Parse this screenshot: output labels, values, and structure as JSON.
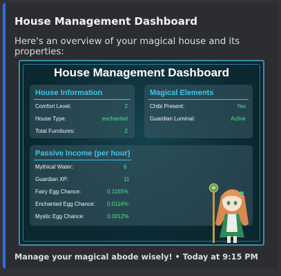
{
  "embed": {
    "title": "House Management Dashboard",
    "description": "Here's an overview of your magical house and its properties:",
    "accent_color": "#2f6fdf",
    "footer": "Manage your magical abode wisely! • Today at 9:15 PM"
  },
  "dashboard": {
    "title": "House Management Dashboard",
    "house_info": {
      "title": "House Information",
      "rows": [
        {
          "label": "Comfort Level:",
          "value": "2"
        },
        {
          "label": "House Type:",
          "value": "enchanted"
        },
        {
          "label": "Total Furnitures:",
          "value": "2"
        }
      ]
    },
    "magical_elements": {
      "title": "Magical Elements",
      "rows": [
        {
          "label": "Chibi Present:",
          "value": "Yes"
        },
        {
          "label": "Guardian Luminal:",
          "value": "Active"
        }
      ]
    },
    "passive_income": {
      "title": "Passive Income (per hour)",
      "rows": [
        {
          "label": "Mythical Water:",
          "value": "6"
        },
        {
          "label": "Guardian XP:",
          "value": "11"
        },
        {
          "label": "Fairy Egg Chance:",
          "value": "0.1155%"
        },
        {
          "label": "Enchanted Egg Chance:",
          "value": "0.0116%"
        },
        {
          "label": "Mystic Egg Chance:",
          "value": "0.0012%"
        }
      ]
    },
    "value_color": "#3ef07a",
    "heading_color": "#39c7e8",
    "illustration_icon": "chibi-guardian-icon"
  }
}
